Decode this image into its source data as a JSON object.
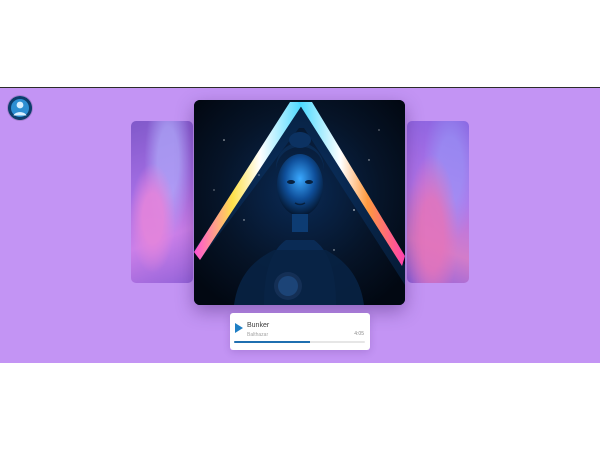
{
  "avatar": {
    "icon": "user-avatar-icon"
  },
  "carousel": {
    "background_color": "#c394f4",
    "slides": [
      {
        "position": "left",
        "icon": "album-cover-left"
      },
      {
        "position": "center",
        "icon": "album-cover-neon-triangle"
      },
      {
        "position": "right",
        "icon": "album-cover-right"
      }
    ]
  },
  "player": {
    "title": "Bunker",
    "artist": "Balthazar",
    "duration": "4:05",
    "progress": 0.58,
    "play_icon": "play-icon",
    "accent_color": "#1f6fb0"
  }
}
